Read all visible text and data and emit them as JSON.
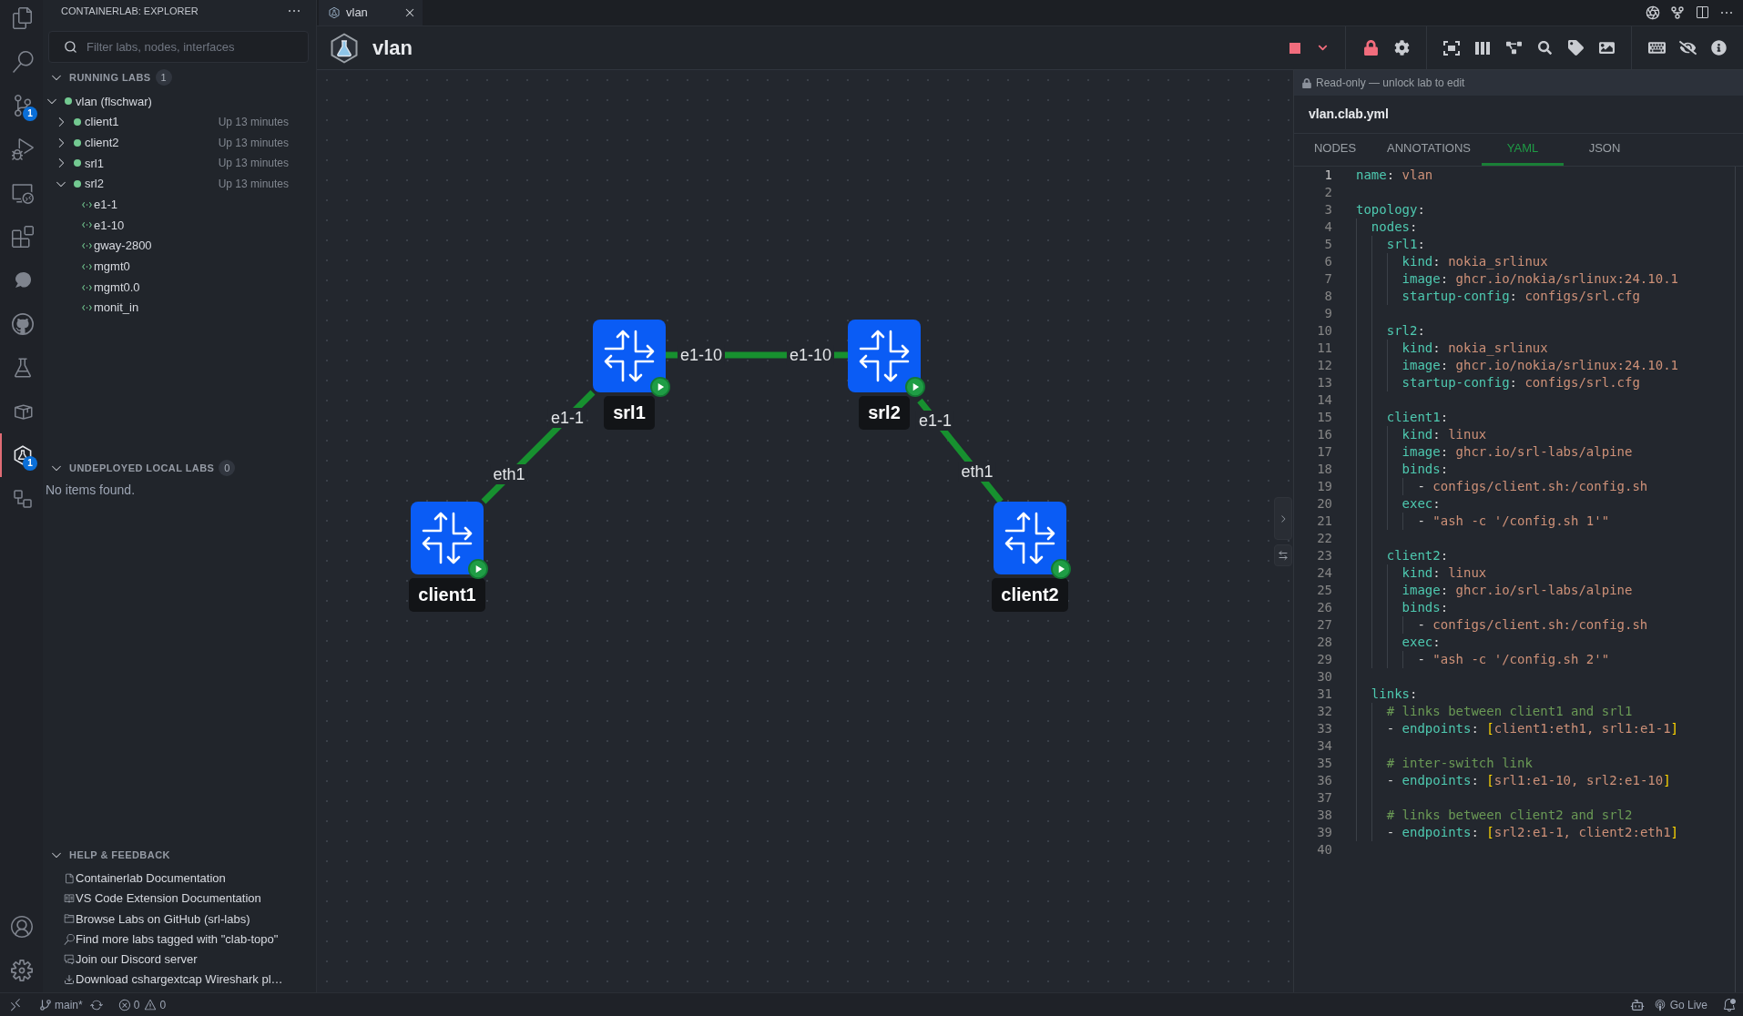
{
  "activity_bar": {
    "items": [
      {
        "selected": false
      },
      {
        "selected": false
      },
      {
        "selected": false,
        "badge": "1"
      },
      {
        "selected": false
      },
      {
        "selected": false
      },
      {
        "selected": false
      },
      {
        "selected": false
      },
      {
        "selected": false
      },
      {
        "selected": false
      },
      {
        "selected": false
      },
      {
        "selected": true,
        "badge": "1"
      },
      {
        "selected": false
      }
    ]
  },
  "sidebar": {
    "title": "CONTAINERLAB: EXPLORER",
    "search": {
      "placeholder": "Filter labs, nodes, interfaces"
    },
    "sections": [
      {
        "kind": "labs",
        "title": "RUNNING LABS",
        "count": "1",
        "expanded": true,
        "items": [
          {
            "kind": "lab",
            "name": "vlan (flschwar)",
            "running": true,
            "expanded": true,
            "children": [
              {
                "kind": "container",
                "name": "client1",
                "running": true,
                "expanded": false,
                "status": "Up 13 minutes"
              },
              {
                "kind": "container",
                "name": "client2",
                "running": true,
                "expanded": false,
                "status": "Up 13 minutes"
              },
              {
                "kind": "container",
                "name": "srl1",
                "running": true,
                "expanded": false,
                "status": "Up 13 minutes"
              },
              {
                "kind": "container",
                "name": "srl2",
                "running": true,
                "expanded": true,
                "status": "Up 13 minutes",
                "children": [
                  {
                    "kind": "interface",
                    "name": "e1-1"
                  },
                  {
                    "kind": "interface",
                    "name": "e1-10"
                  },
                  {
                    "kind": "interface",
                    "name": "gway-2800"
                  },
                  {
                    "kind": "interface",
                    "name": "mgmt0"
                  },
                  {
                    "kind": "interface",
                    "name": "mgmt0.0"
                  },
                  {
                    "kind": "interface",
                    "name": "monit_in"
                  }
                ]
              }
            ]
          }
        ]
      },
      {
        "kind": "labs",
        "title": "UNDEPLOYED LOCAL LABS",
        "count": "0",
        "expanded": true,
        "empty_message": "No items found."
      },
      {
        "kind": "links",
        "title": "HELP & FEEDBACK",
        "expanded": true,
        "items": [
          {
            "label": "Containerlab Documentation"
          },
          {
            "label": "VS Code Extension Documentation"
          },
          {
            "label": "Browse Labs on GitHub (srl-labs)"
          },
          {
            "label": "Find more labs tagged with \"clab-topo\""
          },
          {
            "label": "Join our Discord server"
          },
          {
            "label": "Download cshargextcap Wireshark pl…"
          }
        ]
      }
    ]
  },
  "editor_tabs": [
    {
      "title": "vlan",
      "selected": true
    }
  ],
  "topology": {
    "title": "vlan",
    "locked": true,
    "nodes": [
      {
        "name": "srl1",
        "running": true
      },
      {
        "name": "srl2",
        "running": true
      },
      {
        "name": "client1",
        "running": true
      },
      {
        "name": "client2",
        "running": true
      }
    ],
    "links": [
      {
        "source_label": "eth1",
        "target_label": "e1-1"
      },
      {
        "source_label": "e1-10",
        "target_label": "e1-10"
      },
      {
        "source_label": "e1-1",
        "target_label": "eth1"
      }
    ]
  },
  "panel": {
    "notice": "Read-only — unlock lab to edit",
    "file": "vlan.clab.yml",
    "tabs": [
      {
        "label": "NODES",
        "selected": false
      },
      {
        "label": "ANNOTATIONS",
        "selected": false
      },
      {
        "label": "YAML",
        "selected": true
      },
      {
        "label": "JSON",
        "selected": false
      }
    ],
    "lines": [
      {
        "number": "1",
        "current": true,
        "tokens": [
          {
            "kind": "key",
            "text": "name"
          },
          {
            "kind": "punct",
            "text": ": "
          },
          {
            "kind": "value",
            "text": "vlan"
          }
        ]
      },
      {
        "number": "2",
        "current": false
      },
      {
        "number": "3",
        "current": false,
        "tokens": [
          {
            "kind": "key",
            "text": "topology"
          },
          {
            "kind": "punct",
            "text": ":"
          }
        ]
      },
      {
        "number": "4",
        "current": false,
        "tokens": [
          {
            "kind": "key",
            "text": "  nodes"
          },
          {
            "kind": "punct",
            "text": ":"
          }
        ]
      },
      {
        "number": "5",
        "current": false,
        "tokens": [
          {
            "kind": "key",
            "text": "    srl1"
          },
          {
            "kind": "punct",
            "text": ":"
          }
        ]
      },
      {
        "number": "6",
        "current": false,
        "tokens": [
          {
            "kind": "key",
            "text": "      kind"
          },
          {
            "kind": "punct",
            "text": ": "
          },
          {
            "kind": "value",
            "text": "nokia_srlinux"
          }
        ]
      },
      {
        "number": "7",
        "current": false,
        "tokens": [
          {
            "kind": "key",
            "text": "      image"
          },
          {
            "kind": "punct",
            "text": ": "
          },
          {
            "kind": "value",
            "text": "ghcr.io/nokia/srlinux:24.10.1"
          }
        ]
      },
      {
        "number": "8",
        "current": false,
        "tokens": [
          {
            "kind": "key",
            "text": "      startup-config"
          },
          {
            "kind": "punct",
            "text": ": "
          },
          {
            "kind": "value",
            "text": "configs/srl.cfg"
          }
        ]
      },
      {
        "number": "9",
        "current": false
      },
      {
        "number": "10",
        "current": false,
        "tokens": [
          {
            "kind": "key",
            "text": "    srl2"
          },
          {
            "kind": "punct",
            "text": ":"
          }
        ]
      },
      {
        "number": "11",
        "current": false,
        "tokens": [
          {
            "kind": "key",
            "text": "      kind"
          },
          {
            "kind": "punct",
            "text": ": "
          },
          {
            "kind": "value",
            "text": "nokia_srlinux"
          }
        ]
      },
      {
        "number": "12",
        "current": false,
        "tokens": [
          {
            "kind": "key",
            "text": "      image"
          },
          {
            "kind": "punct",
            "text": ": "
          },
          {
            "kind": "value",
            "text": "ghcr.io/nokia/srlinux:24.10.1"
          }
        ]
      },
      {
        "number": "13",
        "current": false,
        "tokens": [
          {
            "kind": "key",
            "text": "      startup-config"
          },
          {
            "kind": "punct",
            "text": ": "
          },
          {
            "kind": "value",
            "text": "configs/srl.cfg"
          }
        ]
      },
      {
        "number": "14",
        "current": false
      },
      {
        "number": "15",
        "current": false,
        "tokens": [
          {
            "kind": "key",
            "text": "    client1"
          },
          {
            "kind": "punct",
            "text": ":"
          }
        ]
      },
      {
        "number": "16",
        "current": false,
        "tokens": [
          {
            "kind": "key",
            "text": "      kind"
          },
          {
            "kind": "punct",
            "text": ": "
          },
          {
            "kind": "value",
            "text": "linux"
          }
        ]
      },
      {
        "number": "17",
        "current": false,
        "tokens": [
          {
            "kind": "key",
            "text": "      image"
          },
          {
            "kind": "punct",
            "text": ": "
          },
          {
            "kind": "value",
            "text": "ghcr.io/srl-labs/alpine"
          }
        ]
      },
      {
        "number": "18",
        "current": false,
        "tokens": [
          {
            "kind": "key",
            "text": "      binds"
          },
          {
            "kind": "punct",
            "text": ":"
          }
        ]
      },
      {
        "number": "19",
        "current": false,
        "tokens": [
          {
            "kind": "punct",
            "text": "        - "
          },
          {
            "kind": "value",
            "text": "configs/client.sh:/config.sh"
          }
        ]
      },
      {
        "number": "20",
        "current": false,
        "tokens": [
          {
            "kind": "key",
            "text": "      exec"
          },
          {
            "kind": "punct",
            "text": ":"
          }
        ]
      },
      {
        "number": "21",
        "current": false,
        "tokens": [
          {
            "kind": "punct",
            "text": "        - "
          },
          {
            "kind": "value",
            "text": "\"ash -c '/config.sh 1'\""
          }
        ]
      },
      {
        "number": "22",
        "current": false
      },
      {
        "number": "23",
        "current": false,
        "tokens": [
          {
            "kind": "key",
            "text": "    client2"
          },
          {
            "kind": "punct",
            "text": ":"
          }
        ]
      },
      {
        "number": "24",
        "current": false,
        "tokens": [
          {
            "kind": "key",
            "text": "      kind"
          },
          {
            "kind": "punct",
            "text": ": "
          },
          {
            "kind": "value",
            "text": "linux"
          }
        ]
      },
      {
        "number": "25",
        "current": false,
        "tokens": [
          {
            "kind": "key",
            "text": "      image"
          },
          {
            "kind": "punct",
            "text": ": "
          },
          {
            "kind": "value",
            "text": "ghcr.io/srl-labs/alpine"
          }
        ]
      },
      {
        "number": "26",
        "current": false,
        "tokens": [
          {
            "kind": "key",
            "text": "      binds"
          },
          {
            "kind": "punct",
            "text": ":"
          }
        ]
      },
      {
        "number": "27",
        "current": false,
        "tokens": [
          {
            "kind": "punct",
            "text": "        - "
          },
          {
            "kind": "value",
            "text": "configs/client.sh:/config.sh"
          }
        ]
      },
      {
        "number": "28",
        "current": false,
        "tokens": [
          {
            "kind": "key",
            "text": "      exec"
          },
          {
            "kind": "punct",
            "text": ":"
          }
        ]
      },
      {
        "number": "29",
        "current": false,
        "tokens": [
          {
            "kind": "punct",
            "text": "        - "
          },
          {
            "kind": "value",
            "text": "\"ash -c '/config.sh 2'\""
          }
        ]
      },
      {
        "number": "30",
        "current": false
      },
      {
        "number": "31",
        "current": false,
        "tokens": [
          {
            "kind": "key",
            "text": "  links"
          },
          {
            "kind": "punct",
            "text": ":"
          }
        ]
      },
      {
        "number": "32",
        "current": false,
        "tokens": [
          {
            "kind": "comment",
            "text": "    # links between client1 and srl1"
          }
        ]
      },
      {
        "number": "33",
        "current": false,
        "tokens": [
          {
            "kind": "punct",
            "text": "    - "
          },
          {
            "kind": "key",
            "text": "endpoints"
          },
          {
            "kind": "punct",
            "text": ": "
          },
          {
            "kind": "bracket",
            "text": "["
          },
          {
            "kind": "value",
            "text": "client1:eth1, srl1:e1-1"
          },
          {
            "kind": "bracket",
            "text": "]"
          }
        ]
      },
      {
        "number": "34",
        "current": false
      },
      {
        "number": "35",
        "current": false,
        "tokens": [
          {
            "kind": "comment",
            "text": "    # inter-switch link"
          }
        ]
      },
      {
        "number": "36",
        "current": false,
        "tokens": [
          {
            "kind": "punct",
            "text": "    - "
          },
          {
            "kind": "key",
            "text": "endpoints"
          },
          {
            "kind": "punct",
            "text": ": "
          },
          {
            "kind": "bracket",
            "text": "["
          },
          {
            "kind": "value",
            "text": "srl1:e1-10, srl2:e1-10"
          },
          {
            "kind": "bracket",
            "text": "]"
          }
        ]
      },
      {
        "number": "37",
        "current": false
      },
      {
        "number": "38",
        "current": false,
        "tokens": [
          {
            "kind": "comment",
            "text": "    # links between client2 and srl2"
          }
        ]
      },
      {
        "number": "39",
        "current": false,
        "tokens": [
          {
            "kind": "punct",
            "text": "    - "
          },
          {
            "kind": "key",
            "text": "endpoints"
          },
          {
            "kind": "punct",
            "text": ": "
          },
          {
            "kind": "bracket",
            "text": "["
          },
          {
            "kind": "value",
            "text": "srl2:e1-1, client2:eth1"
          },
          {
            "kind": "bracket",
            "text": "]"
          }
        ]
      },
      {
        "number": "40",
        "current": false
      }
    ]
  },
  "status_bar": {
    "branch": "main*",
    "errors": "0",
    "warnings": "0",
    "live": "Go Live"
  }
}
